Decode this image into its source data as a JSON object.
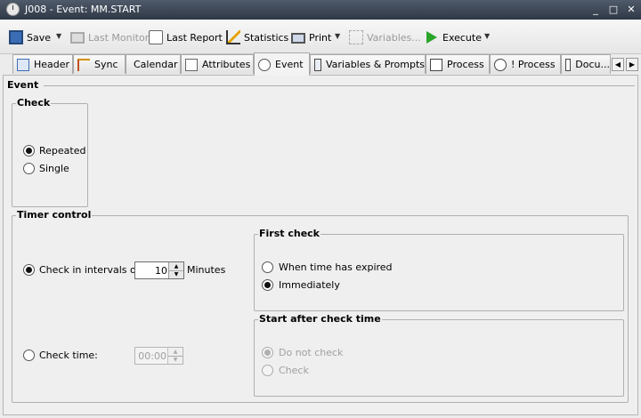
{
  "window": {
    "title": "J008 - Event: MM.START",
    "minimize": "_",
    "maximize": "□",
    "close": "✕"
  },
  "toolbar": {
    "save": "Save",
    "last_monitor": "Last Monitor",
    "last_report": "Last Report",
    "statistics": "Statistics",
    "print": "Print",
    "variables": "Variables...",
    "execute": "Execute"
  },
  "tabs": [
    "Header",
    "Sync",
    "Calendar",
    "Attributes",
    "Event",
    "Variables & Prompts",
    "Process",
    "! Process",
    "Docu..."
  ],
  "content": {
    "event_label": "Event",
    "check_group": {
      "title": "Check",
      "repeated": "Repeated",
      "single": "Single"
    },
    "timer_control": {
      "title": "Timer control",
      "interval_label": "Check in intervals of:",
      "interval_value": "10",
      "interval_unit": "Minutes",
      "check_time_label": "Check time:",
      "check_time_value": "00:00"
    },
    "first_check": {
      "title": "First check",
      "expired": "When time has expired",
      "immediately": "Immediately"
    },
    "start_after": {
      "title": "Start after check time",
      "do_not_check": "Do not check",
      "check": "Check"
    }
  },
  "colors": {
    "title_bar": "#3a4453",
    "execute_green": "#2aa52a"
  }
}
